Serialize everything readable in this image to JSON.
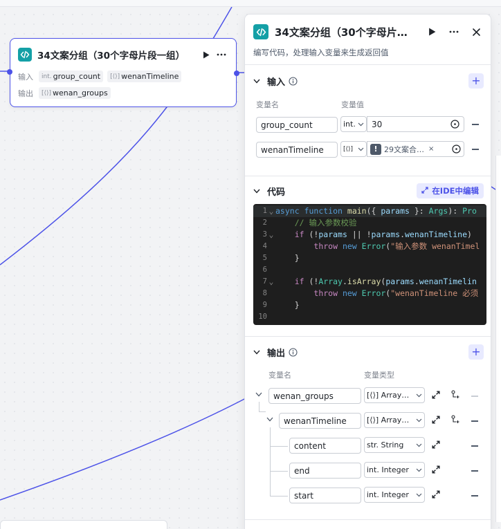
{
  "node": {
    "title": "34文案分组（30个字母片段一组）",
    "input_label": "输入",
    "output_label": "输出",
    "inputs": [
      {
        "type": "int.",
        "name": "group_count"
      },
      {
        "type": "[⟨⟩]",
        "name": "wenanTimeline"
      }
    ],
    "outputs": [
      {
        "type": "[⟨⟩]",
        "name": "wenan_groups"
      }
    ]
  },
  "panel": {
    "title": "34文案分组（30个字母片…",
    "description": "编写代码，处理输入变量来生成返回值",
    "input_section": {
      "title": "输入",
      "col_name": "变量名",
      "col_value": "变量值",
      "rows": [
        {
          "name": "group_count",
          "type": "int.",
          "value": "30"
        },
        {
          "name": "wenanTimeline",
          "type": "[⟨⟩]",
          "value": "29文案合…",
          "warn": "!"
        }
      ]
    },
    "code_section": {
      "title": "代码",
      "ide_button": "在IDE中编辑"
    },
    "output_section": {
      "title": "输出",
      "col_name": "变量名",
      "col_type": "变量类型",
      "rows": [
        {
          "name": "wenan_groups",
          "type": "[⟨⟩] Array…"
        },
        {
          "name": "wenanTimeline",
          "type": "[⟨⟩] Array…"
        },
        {
          "name": "content",
          "type": "str. String"
        },
        {
          "name": "end",
          "type": "int. Integer"
        },
        {
          "name": "start",
          "type": "int. Integer"
        }
      ]
    }
  },
  "colors": {
    "accent": "#4d53e8",
    "code_icon": "#14a0a6",
    "edge": "#4d53e8"
  },
  "icons": [
    "code-icon",
    "play-icon",
    "more-icon",
    "close-icon",
    "chevron-down-icon",
    "info-icon",
    "plus-icon",
    "expand-icon",
    "add-child-icon",
    "variable-picker-icon",
    "clear-icon"
  ]
}
